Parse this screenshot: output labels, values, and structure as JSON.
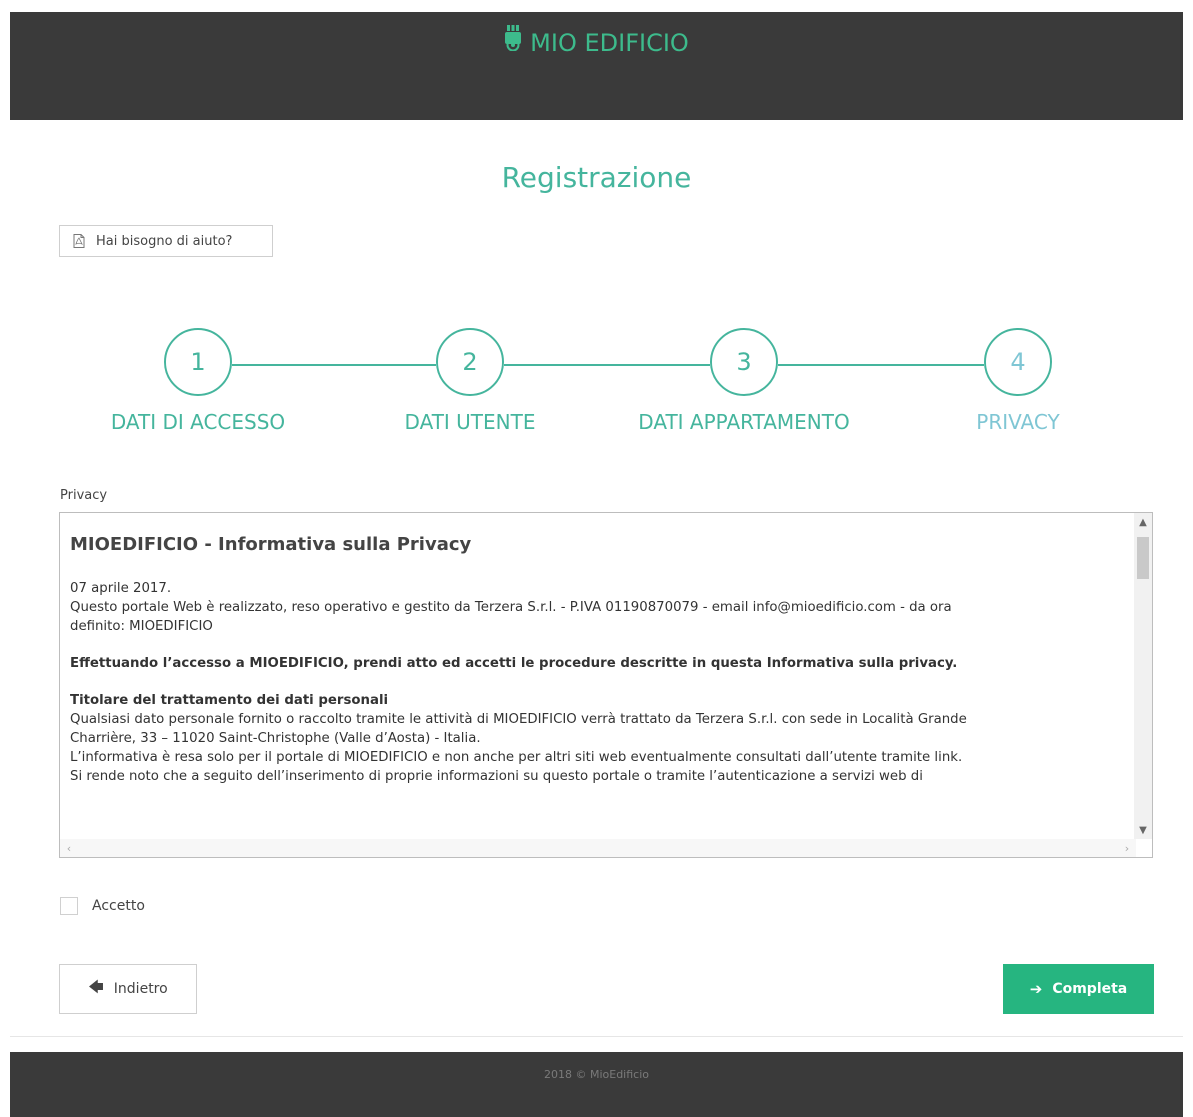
{
  "app": {
    "brand": "MIO EDIFICIO"
  },
  "page": {
    "title": "Registrazione",
    "help_label": "Hai bisogno di aiuto?"
  },
  "stepper": {
    "steps": [
      {
        "number": "1",
        "label": "DATI DI ACCESSO"
      },
      {
        "number": "2",
        "label": "DATI UTENTE"
      },
      {
        "number": "3",
        "label": "DATI APPARTAMENTO"
      },
      {
        "number": "4",
        "label": "PRIVACY"
      }
    ],
    "active_step": 4
  },
  "privacy": {
    "field_label": "Privacy",
    "heading": "MIOEDIFICIO - Informativa sulla Privacy",
    "date": "07 aprile 2017.",
    "intro_line1": "Questo portale Web è realizzato, reso operativo e gestito da Terzera S.r.l. - P.IVA 01190870079 - email info@mioedificio.com - da ora",
    "intro_line2": "definito: MIOEDIFICIO",
    "notice": "Effettuando l’accesso a MIOEDIFICIO, prendi atto ed accetti le procedure descritte in questa Informativa sulla privacy.",
    "section_title": "Titolare del trattamento dei dati personali",
    "section_line1": "Qualsiasi dato personale fornito o raccolto tramite le attività di MIOEDIFICIO verrà trattato da Terzera S.r.l. con sede in Località Grande",
    "section_line2": "Charrière, 33 – 11020 Saint-Christophe (Valle d’Aosta) - Italia.",
    "section_line3": "L’informativa è resa solo per il portale di MIOEDIFICIO e non anche per altri siti web eventualmente consultati dall’utente tramite link.",
    "section_line4": "Si rende noto che a seguito dell’inserimento di proprie informazioni su questo portale o tramite l’autenticazione a servizi web di"
  },
  "form": {
    "accept_label": "Accetto",
    "accepted": false,
    "back_label": "Indietro",
    "complete_label": "Completa"
  },
  "footer": {
    "text": "2018 © MioEdificio"
  },
  "colors": {
    "brand": "#3dbb8c",
    "accent": "#45b59d",
    "primary_button": "#26b580",
    "header_bg": "#3a3a3a"
  }
}
